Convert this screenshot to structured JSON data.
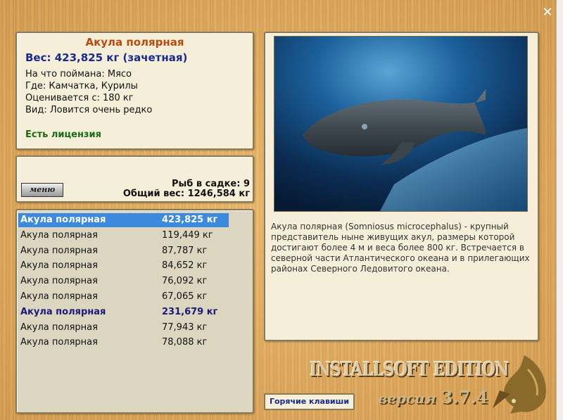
{
  "window": {
    "close_label": "✕"
  },
  "fish_info": {
    "title": "Акула полярная",
    "weight": "Вес: 423,825 кг (зачетная)",
    "bait": "На что поймана: Мясо",
    "location": "Где: Камчатка, Курилы",
    "rated_from": "Оценивается с: 180 кг",
    "rarity": "Вид: Ловится очень редко",
    "license": "Есть лицензия"
  },
  "cage": {
    "menu_label": "меню",
    "count": "Рыб в садке: 9",
    "total": "Общий вес: 1246,584 кг"
  },
  "catch_list": [
    {
      "name": "Акула полярная",
      "weight": "423,825 кг",
      "state": "selected"
    },
    {
      "name": "Акула полярная",
      "weight": "119,449 кг",
      "state": "normal"
    },
    {
      "name": "Акула полярная",
      "weight": "87,787 кг",
      "state": "normal"
    },
    {
      "name": "Акула полярная",
      "weight": "84,652 кг",
      "state": "normal"
    },
    {
      "name": "Акула полярная",
      "weight": "76,092 кг",
      "state": "normal"
    },
    {
      "name": "Акула полярная",
      "weight": "67,065 кг",
      "state": "normal"
    },
    {
      "name": "Акула полярная",
      "weight": "231,679 кг",
      "state": "highlight"
    },
    {
      "name": "Акула полярная",
      "weight": "77,943 кг",
      "state": "normal"
    },
    {
      "name": "Акула полярная",
      "weight": "78,088 кг",
      "state": "normal"
    }
  ],
  "description": "Акула полярная (Somniosus microcephalus) - крупный представитель ныне живущих акул, размеры которой достигают более 4 м и веса более 800 кг. Встречается в северной части Атлантического океана и в прилегающих районах Северного Ледовитого океана.",
  "hotkeys_label": "Горячие клавиши",
  "branding": {
    "edition": "INSTALLSOFT EDITION",
    "version_word": "версия",
    "version_number": "3.7.4"
  },
  "colors": {
    "selected_row": "#3c8ae0",
    "title": "#b84a10",
    "weight": "#1a2a8a",
    "license": "#1b6a16"
  }
}
